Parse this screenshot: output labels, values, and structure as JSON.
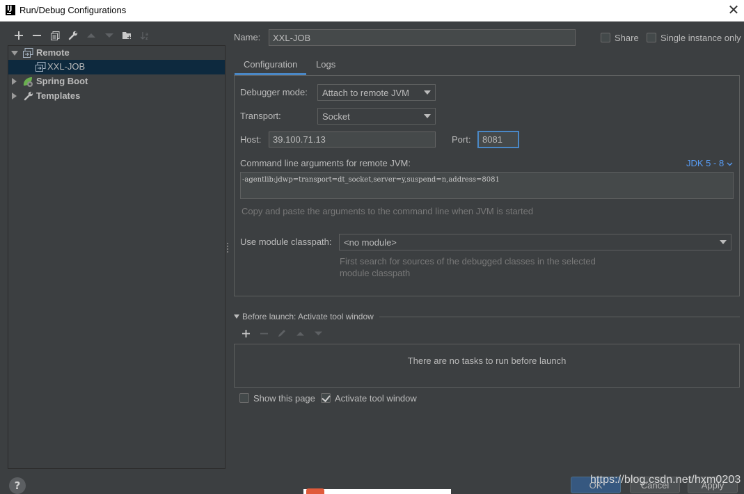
{
  "window": {
    "title": "Run/Debug Configurations",
    "app_icon_letter": "IJ"
  },
  "toolbar": {
    "icons": [
      "add-icon",
      "remove-icon",
      "copy-icon",
      "wrench-icon",
      "move-up-icon",
      "move-down-icon",
      "new-folder-icon",
      "sort-icon"
    ]
  },
  "tree": {
    "remote": "Remote",
    "xxl_job": "XXL-JOB",
    "spring_boot": "Spring Boot",
    "templates": "Templates"
  },
  "form": {
    "name_label": "Name:",
    "name_value": "XXL-JOB",
    "share_label": "Share",
    "single_instance_label": "Single instance only"
  },
  "tabs": {
    "configuration": "Configuration",
    "logs": "Logs"
  },
  "config": {
    "debugger_mode_label": "Debugger mode:",
    "debugger_mode_value": "Attach to remote JVM",
    "transport_label": "Transport:",
    "transport_value": "Socket",
    "host_label": "Host:",
    "host_value": "39.100.71.13",
    "port_label": "Port:",
    "port_value": "8081",
    "cmdline_label": "Command line arguments for remote JVM:",
    "jdk_link": "JDK 5 - 8",
    "cmdline_value": "-agentlib:jdwp=transport=dt_socket,server=y,suspend=n,address=8081",
    "cmdline_hint": "Copy and paste the arguments to the command line when JVM is started",
    "module_label": "Use module classpath:",
    "module_value": "<no module>",
    "module_hint_1": "First search for sources of the debugged classes in the selected",
    "module_hint_2": "module classpath"
  },
  "before_launch": {
    "title": "Before launch: Activate tool window",
    "empty_text": "There are no tasks to run before launch",
    "show_page_label": "Show this page",
    "activate_tool_label": "Activate tool window"
  },
  "buttons": {
    "ok": "OK",
    "cancel": "Cancel",
    "apply": "Apply"
  },
  "watermark": "https://blog.csdn.net/hxm0203",
  "help": "?",
  "colors": {
    "background": "#3c3f41",
    "selection": "#0d293e",
    "link": "#589df6",
    "accent": "#4a88c7"
  }
}
